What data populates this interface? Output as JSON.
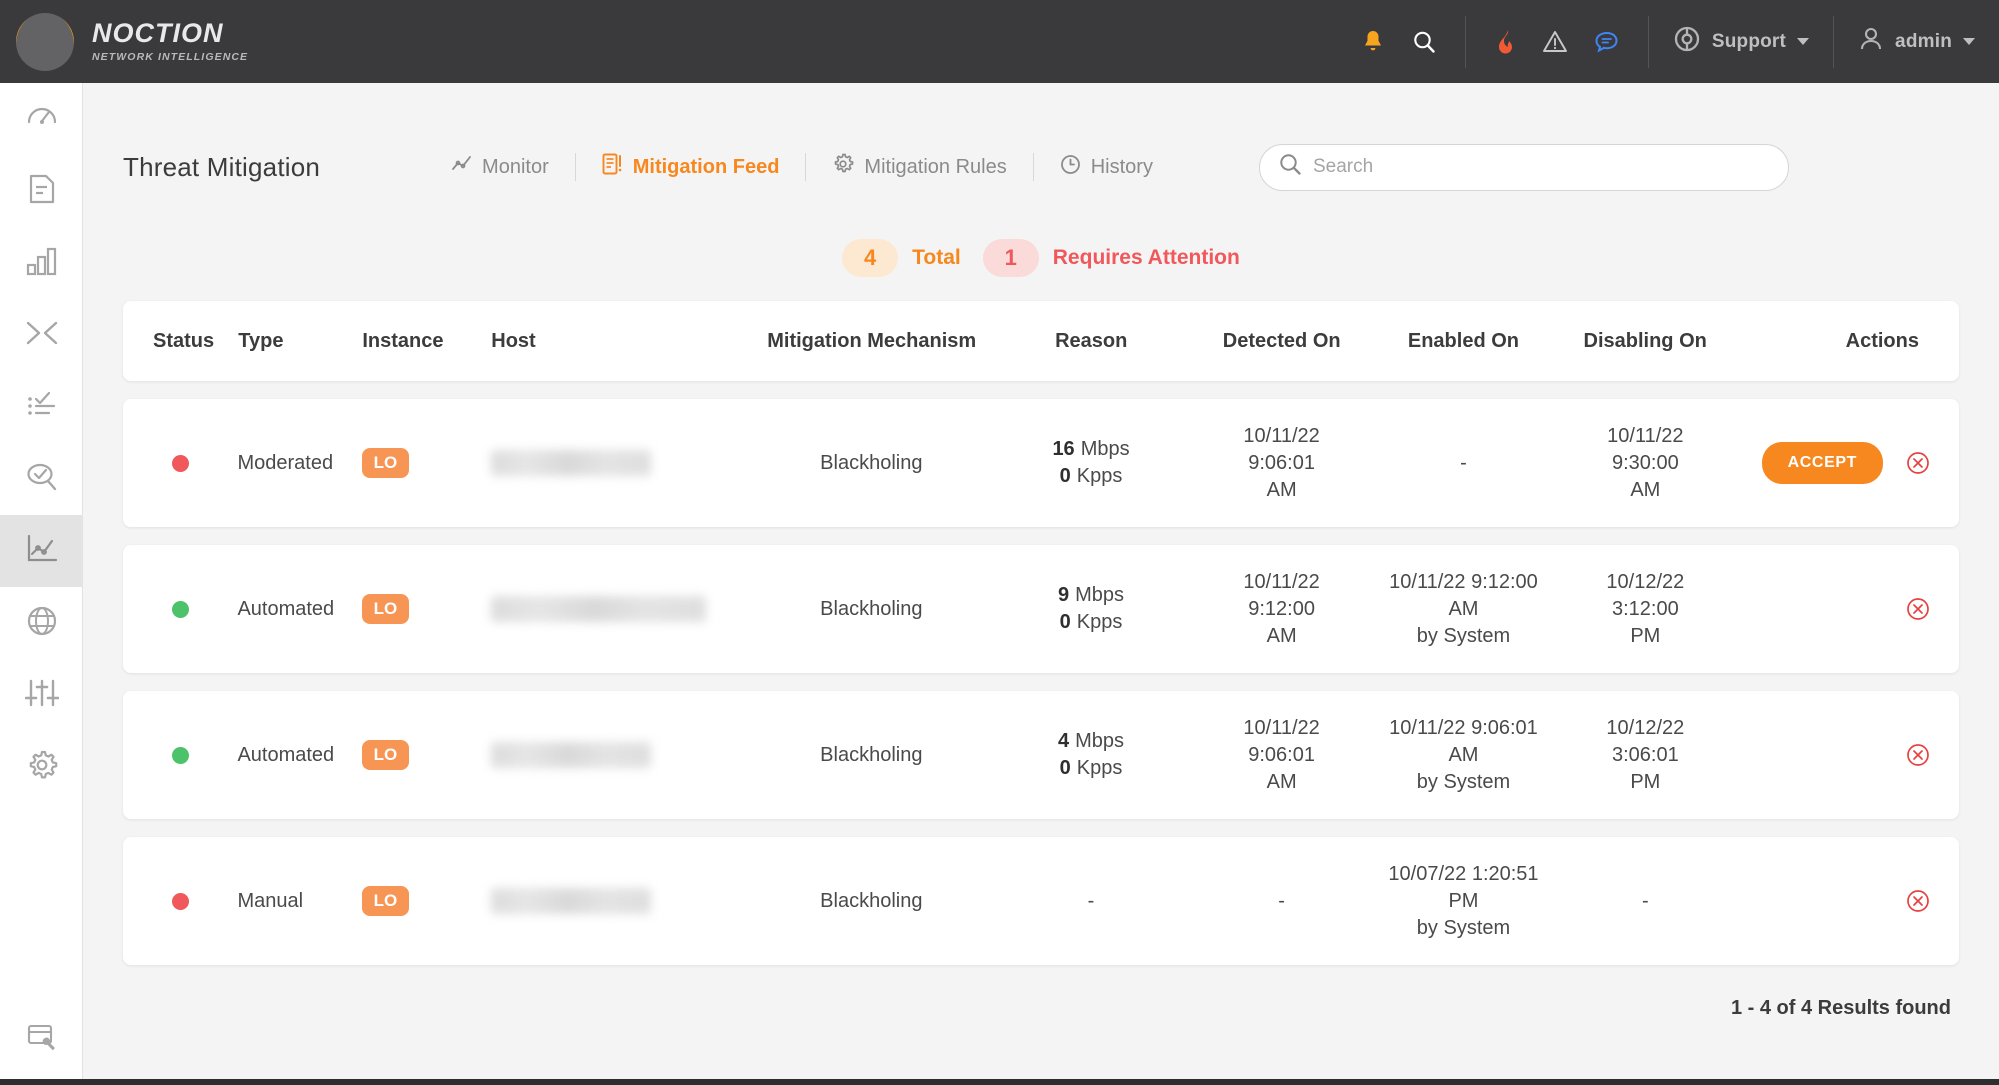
{
  "brand": {
    "name": "NOCTION",
    "tagline": "NETWORK INTELLIGENCE"
  },
  "topbar": {
    "icons": [
      {
        "name": "bell-icon",
        "glyph": "▲"
      },
      {
        "name": "search-icon",
        "glyph": "⌕"
      },
      {
        "name": "flame-icon",
        "glyph": "◆"
      },
      {
        "name": "warning-icon",
        "glyph": "⚠"
      },
      {
        "name": "chat-icon",
        "glyph": "●"
      }
    ],
    "support_label": "Support",
    "user_label": "admin"
  },
  "sidebar": {
    "items": [
      {
        "name": "sidebar-item-dashboard",
        "icon": "speedometer-icon",
        "active": false
      },
      {
        "name": "sidebar-item-reports",
        "icon": "document-icon",
        "active": false
      },
      {
        "name": "sidebar-item-statistics",
        "icon": "bar-chart-icon",
        "active": false
      },
      {
        "name": "sidebar-item-optimization",
        "icon": "compress-arrows-icon",
        "active": false
      },
      {
        "name": "sidebar-item-policies",
        "icon": "checklist-icon",
        "active": false
      },
      {
        "name": "sidebar-item-inspector",
        "icon": "search-check-icon",
        "active": false
      },
      {
        "name": "sidebar-item-threat-mitigation",
        "icon": "line-chart-icon",
        "active": true
      },
      {
        "name": "sidebar-item-network",
        "icon": "globe-icon",
        "active": false
      },
      {
        "name": "sidebar-item-tuning",
        "icon": "sliders-icon",
        "active": false
      },
      {
        "name": "sidebar-item-settings",
        "icon": "gear-icon",
        "active": false
      }
    ],
    "bottom_item": {
      "name": "sidebar-item-console",
      "icon": "window-wrench-icon"
    }
  },
  "page": {
    "title": "Threat Mitigation"
  },
  "tabs": [
    {
      "label": "Monitor",
      "icon": "line-chart-icon",
      "active": false
    },
    {
      "label": "Mitigation Feed",
      "icon": "list-alert-icon",
      "active": true
    },
    {
      "label": "Mitigation Rules",
      "icon": "gear-icon",
      "active": false
    },
    {
      "label": "History",
      "icon": "clock-icon",
      "active": false
    }
  ],
  "search": {
    "placeholder": "Search",
    "value": ""
  },
  "summary": {
    "total_count": "4",
    "total_label": "Total",
    "attention_count": "1",
    "attention_label": "Requires Attention"
  },
  "table": {
    "columns": [
      "Status",
      "Type",
      "Instance",
      "Host",
      "Mitigation Mechanism",
      "Reason",
      "Detected On",
      "Enabled On",
      "Disabling On",
      "Actions"
    ],
    "rows": [
      {
        "status": "red",
        "type": "Moderated",
        "instance": "LO",
        "host": "",
        "mechanism": "Blackholing",
        "reason_mbps_value": "16",
        "reason_mbps_unit": "Mbps",
        "reason_kpps_value": "0",
        "reason_kpps_unit": "Kpps",
        "detected_on": "10/11/22\n9:06:01\nAM",
        "enabled_on": "-",
        "disabling_on": "10/11/22\n9:30:00\nAM",
        "accept_label": "ACCEPT",
        "has_accept": true
      },
      {
        "status": "green",
        "type": "Automated",
        "instance": "LO",
        "host": "",
        "mechanism": "Blackholing",
        "reason_mbps_value": "9",
        "reason_mbps_unit": "Mbps",
        "reason_kpps_value": "0",
        "reason_kpps_unit": "Kpps",
        "detected_on": "10/11/22\n9:12:00\nAM",
        "enabled_on": "10/11/22 9:12:00\nAM\nby System",
        "disabling_on": "10/12/22\n3:12:00\nPM",
        "accept_label": "",
        "has_accept": false
      },
      {
        "status": "green",
        "type": "Automated",
        "instance": "LO",
        "host": "",
        "mechanism": "Blackholing",
        "reason_mbps_value": "4",
        "reason_mbps_unit": "Mbps",
        "reason_kpps_value": "0",
        "reason_kpps_unit": "Kpps",
        "detected_on": "10/11/22\n9:06:01\nAM",
        "enabled_on": "10/11/22 9:06:01\nAM\nby System",
        "disabling_on": "10/12/22\n3:06:01\nPM",
        "accept_label": "",
        "has_accept": false
      },
      {
        "status": "red",
        "type": "Manual",
        "instance": "LO",
        "host": "",
        "mechanism": "Blackholing",
        "reason_mbps_value": "",
        "reason_mbps_unit": "",
        "reason_kpps_value": "",
        "reason_kpps_unit": "",
        "reason_dash": "-",
        "detected_on": "-",
        "enabled_on": "10/07/22 1:20:51\nPM\nby System",
        "disabling_on": "-",
        "accept_label": "",
        "has_accept": false
      }
    ]
  },
  "footer": {
    "results": "1 - 4 of 4 Results found"
  },
  "colors": {
    "accent_orange": "#f7881f",
    "status_red": "#f0585b",
    "status_green": "#4cc36a",
    "topbar_dark": "#3a3a3c",
    "page_bg": "#f4f4f4"
  }
}
